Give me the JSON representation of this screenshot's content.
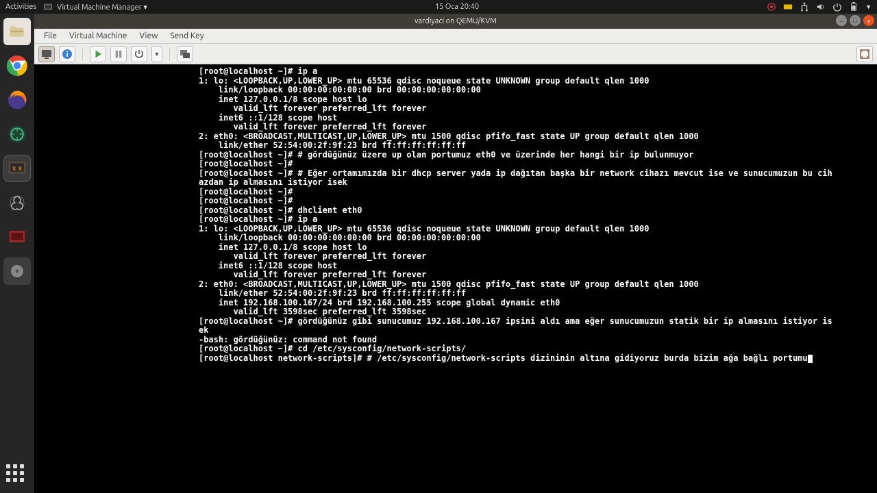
{
  "top_panel": {
    "activities": "Activities",
    "app_label": "Virtual Machine Manager ▾",
    "clock": "15 Oca  20:40"
  },
  "vm_window": {
    "title": "vardiyaci on QEMU/KVM",
    "menu": {
      "file": "File",
      "vm": "Virtual Machine",
      "view": "View",
      "sendkey": "Send Key"
    }
  },
  "terminal_lines": [
    "[root@localhost ~]# ip a",
    "1: lo: <LOOPBACK,UP,LOWER_UP> mtu 65536 qdisc noqueue state UNKNOWN group default qlen 1000",
    "    link/loopback 00:00:00:00:00:00 brd 00:00:00:00:00:00",
    "    inet 127.0.0.1/8 scope host lo",
    "       valid_lft forever preferred_lft forever",
    "    inet6 ::1/128 scope host",
    "       valid_lft forever preferred_lft forever",
    "2: eth0: <BROADCAST,MULTICAST,UP,LOWER_UP> mtu 1500 qdisc pfifo_fast state UP group default qlen 1000",
    "    link/ether 52:54:00:2f:9f:23 brd ff:ff:ff:ff:ff:ff",
    "[root@localhost ~]# # gördüğünüz üzere up olan portumuz eth0 ve üzerinde her hangi bir ip bulunmuyor",
    "[root@localhost ~]#",
    "[root@localhost ~]# # Eğer ortamımızda bir dhcp server yada ip dağıtan başka bir network cihazı mevcut ise ve sunucumuzun bu cih",
    "azdan ip almasını istiyor isek",
    "[root@localhost ~]#",
    "[root@localhost ~]#",
    "[root@localhost ~]# dhclient eth0",
    "[root@localhost ~]# ip a",
    "1: lo: <LOOPBACK,UP,LOWER_UP> mtu 65536 qdisc noqueue state UNKNOWN group default qlen 1000",
    "    link/loopback 00:00:00:00:00:00 brd 00:00:00:00:00:00",
    "    inet 127.0.0.1/8 scope host lo",
    "       valid_lft forever preferred_lft forever",
    "    inet6 ::1/128 scope host",
    "       valid_lft forever preferred_lft forever",
    "2: eth0: <BROADCAST,MULTICAST,UP,LOWER_UP> mtu 1500 qdisc pfifo_fast state UP group default qlen 1000",
    "    link/ether 52:54:00:2f:9f:23 brd ff:ff:ff:ff:ff:ff",
    "    inet 192.168.100.167/24 brd 192.168.100.255 scope global dynamic eth0",
    "       valid_lft 3598sec preferred_lft 3598sec",
    "[root@localhost ~]# gördüğünüz gibi sunucumuz 192.168.100.167 ipsini aldı ama eğer sunucumuzun statik bir ip almasını istiyor is",
    "ek",
    "-bash: gördüğünüz: command not found",
    "[root@localhost ~]# cd /etc/sysconfig/network-scripts/",
    "[root@localhost network-scripts]# # /etc/sysconfig/network-scripts dizininin altına gidiyoruz burda bizim ağa bağlı portumu"
  ]
}
